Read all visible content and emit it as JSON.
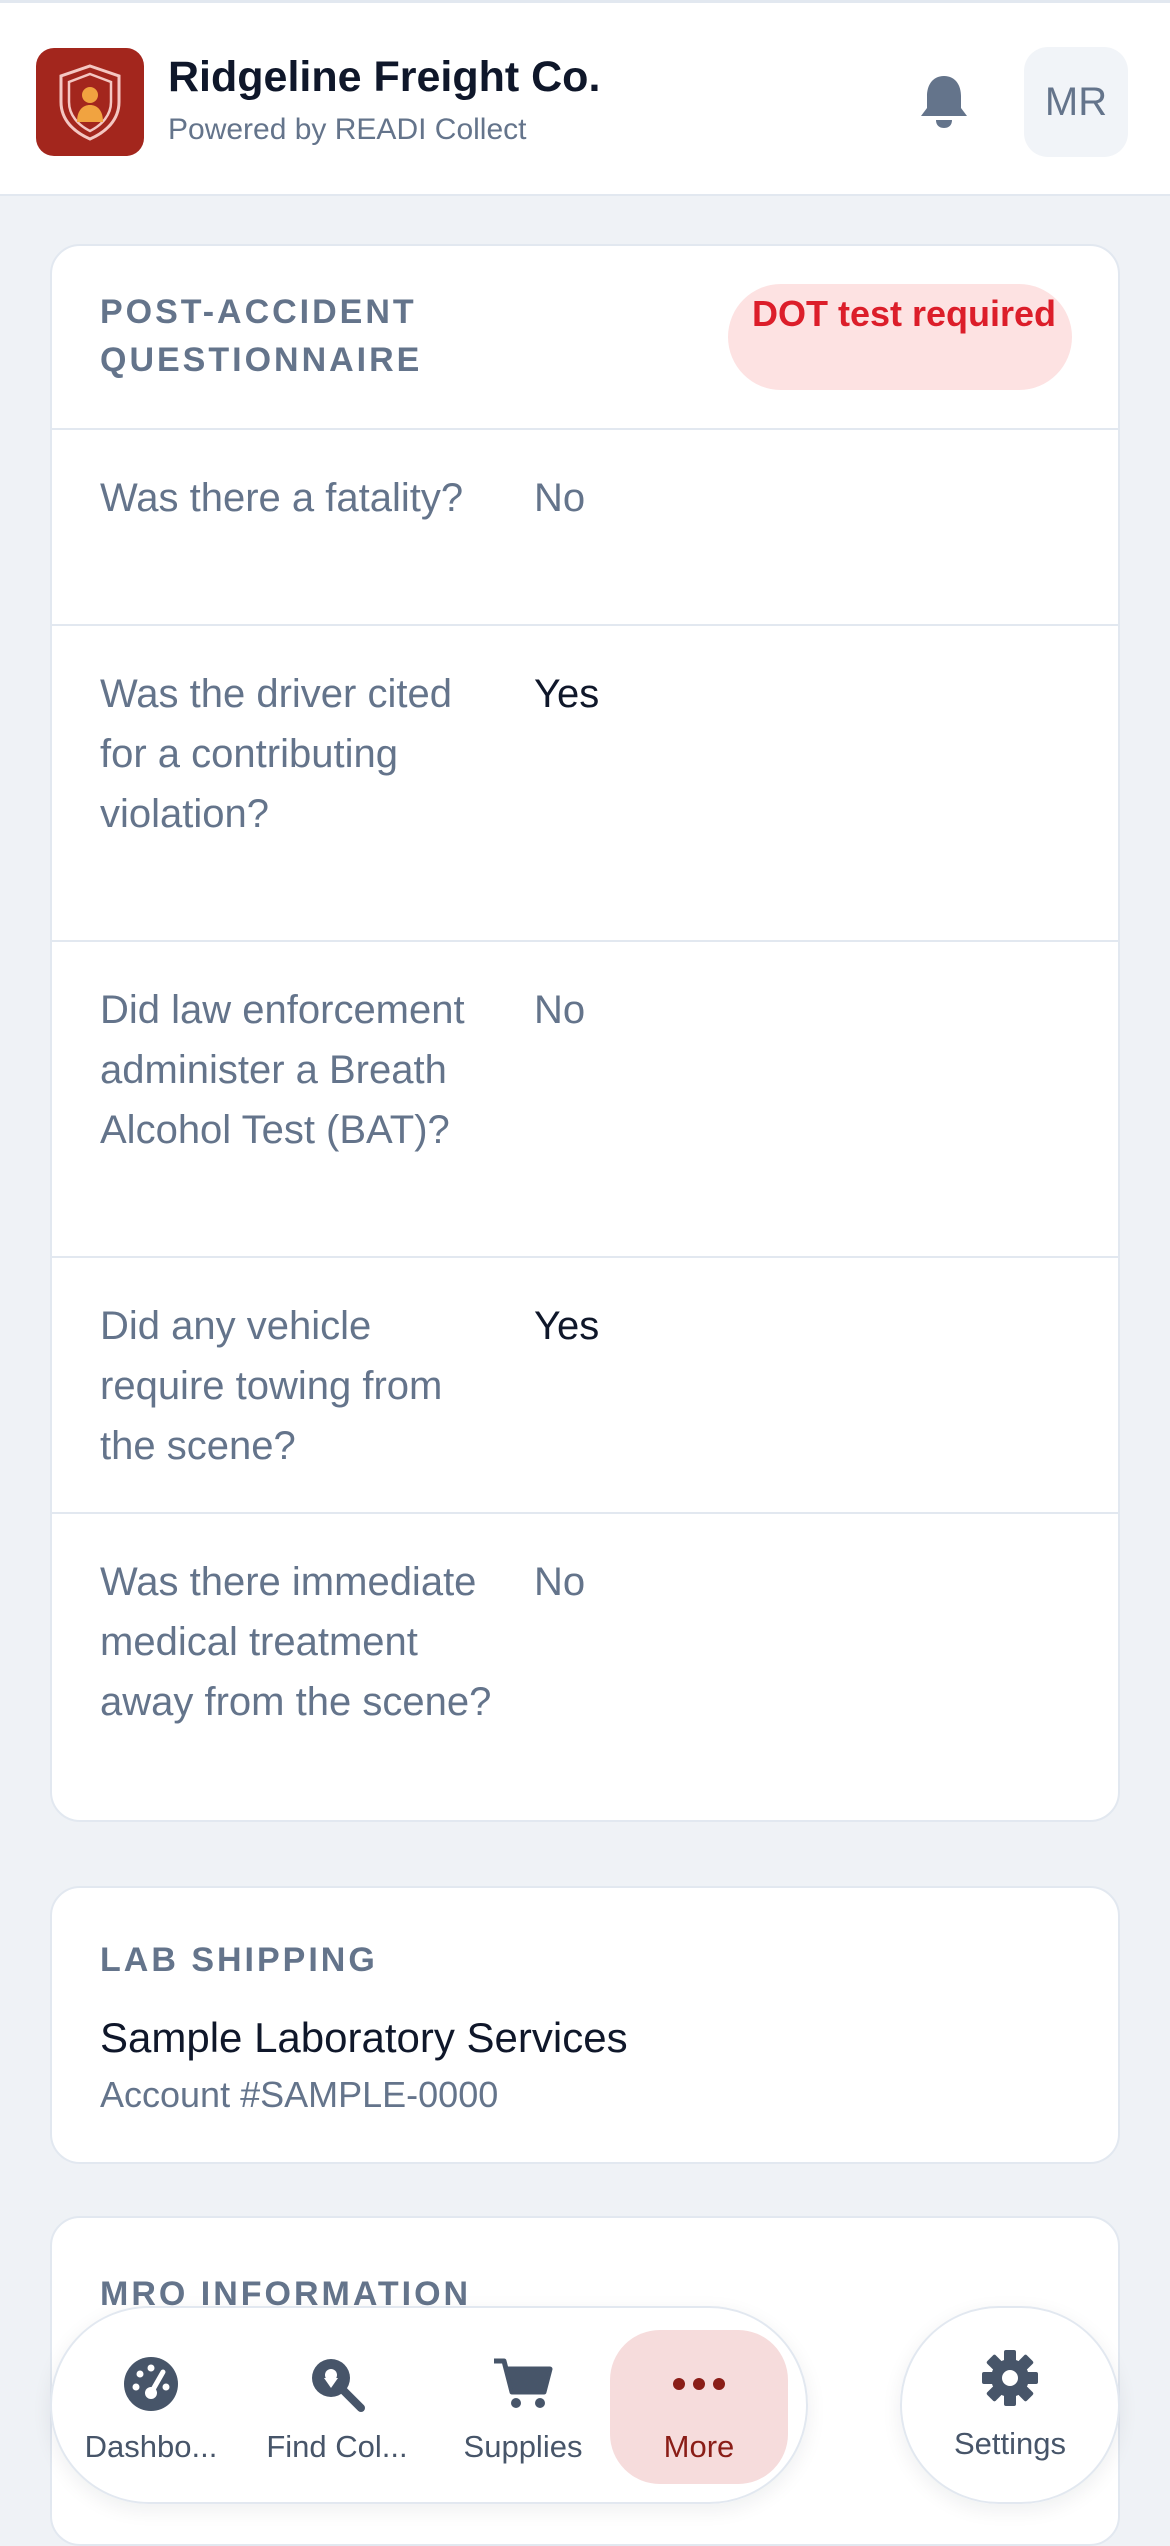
{
  "header": {
    "company_name": "Ridgeline Freight Co.",
    "powered_by": "Powered by READI Collect",
    "avatar_initials": "MR",
    "brand_color": "#a3261d"
  },
  "questionnaire": {
    "title": "POST-ACCIDENT QUESTIONNAIRE",
    "badge": "DOT test required",
    "rows": [
      {
        "question": "Was there a fatality?",
        "answer": "No"
      },
      {
        "question": "Was the driver cited for a contributing violation?",
        "answer": "Yes"
      },
      {
        "question": "Did law enforcement administer a Breath Alcohol Test (BAT)?",
        "answer": "No"
      },
      {
        "question": "Did any vehicle require towing from the scene?",
        "answer": "Yes"
      },
      {
        "question": "Was there immediate medical treatment away from the scene?",
        "answer": "No"
      }
    ]
  },
  "lab_shipping": {
    "title": "LAB SHIPPING",
    "lab_name": "Sample Laboratory Services",
    "account": "Account #SAMPLE-0000"
  },
  "mro": {
    "title": "MRO INFORMATION"
  },
  "nav": {
    "items": [
      {
        "label": "Dashbo...",
        "icon": "dashboard-gauge-icon"
      },
      {
        "label": "Find Col...",
        "icon": "location-search-icon"
      },
      {
        "label": "Supplies",
        "icon": "cart-icon"
      },
      {
        "label": "More",
        "icon": "more-dots-icon",
        "active": true
      }
    ],
    "settings_label": "Settings",
    "settings_icon": "gear-icon"
  }
}
